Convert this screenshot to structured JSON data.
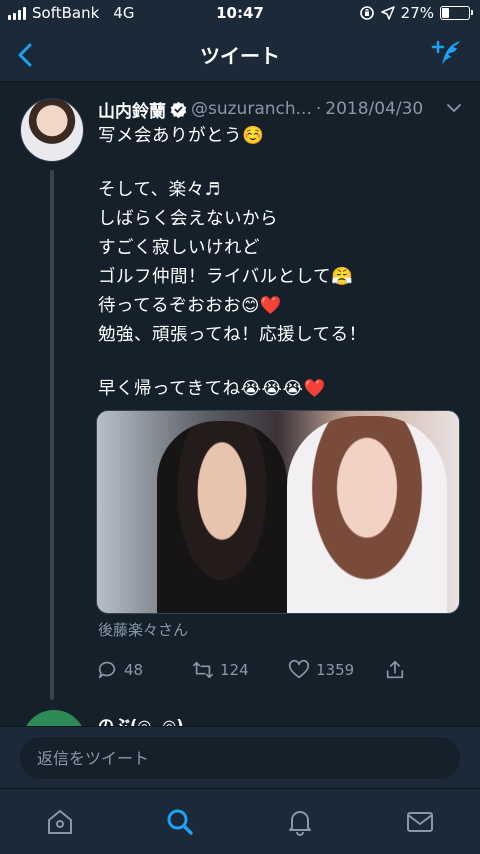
{
  "status_bar": {
    "carrier": "SoftBank",
    "network": "4G",
    "time": "10:47",
    "battery_percent": "27%",
    "battery_level": 0.27
  },
  "header": {
    "title": "ツイート",
    "back_icon": "chevron-left-icon",
    "compose_icon": "compose-tweet-icon"
  },
  "tweet": {
    "author_name": "山内鈴蘭",
    "handle": "@suzuranch...",
    "separator": "·",
    "date": "2018/04/30",
    "verified": true,
    "lines": [
      "写メ会ありがとう☺️",
      "そして、楽々♬",
      "しばらく会えないから",
      "すごく寂しいけれど",
      "ゴルフ仲間！ライバルとして😤",
      "待ってるぞおおお😊❤️",
      "勉強、頑張ってね！応援してる！",
      "早く帰ってきてね😭😭😭❤️"
    ],
    "photo_tag": "後藤楽々さん",
    "stats": {
      "replies": "48",
      "retweets": "124",
      "likes": "1359"
    }
  },
  "next_reply": {
    "name_preview": "のぶ(◎ᴗ◎)"
  },
  "reply_box": {
    "placeholder": "返信をツイート"
  },
  "tabs": [
    {
      "name": "home",
      "icon": "home-icon"
    },
    {
      "name": "search",
      "icon": "search-icon",
      "active": true
    },
    {
      "name": "notifications",
      "icon": "bell-icon"
    },
    {
      "name": "messages",
      "icon": "mail-icon"
    }
  ],
  "colors": {
    "background": "#15202b",
    "bar": "#1c2938",
    "accent": "#1da1f2",
    "muted": "#8899a6",
    "heart": "#e0245e"
  }
}
